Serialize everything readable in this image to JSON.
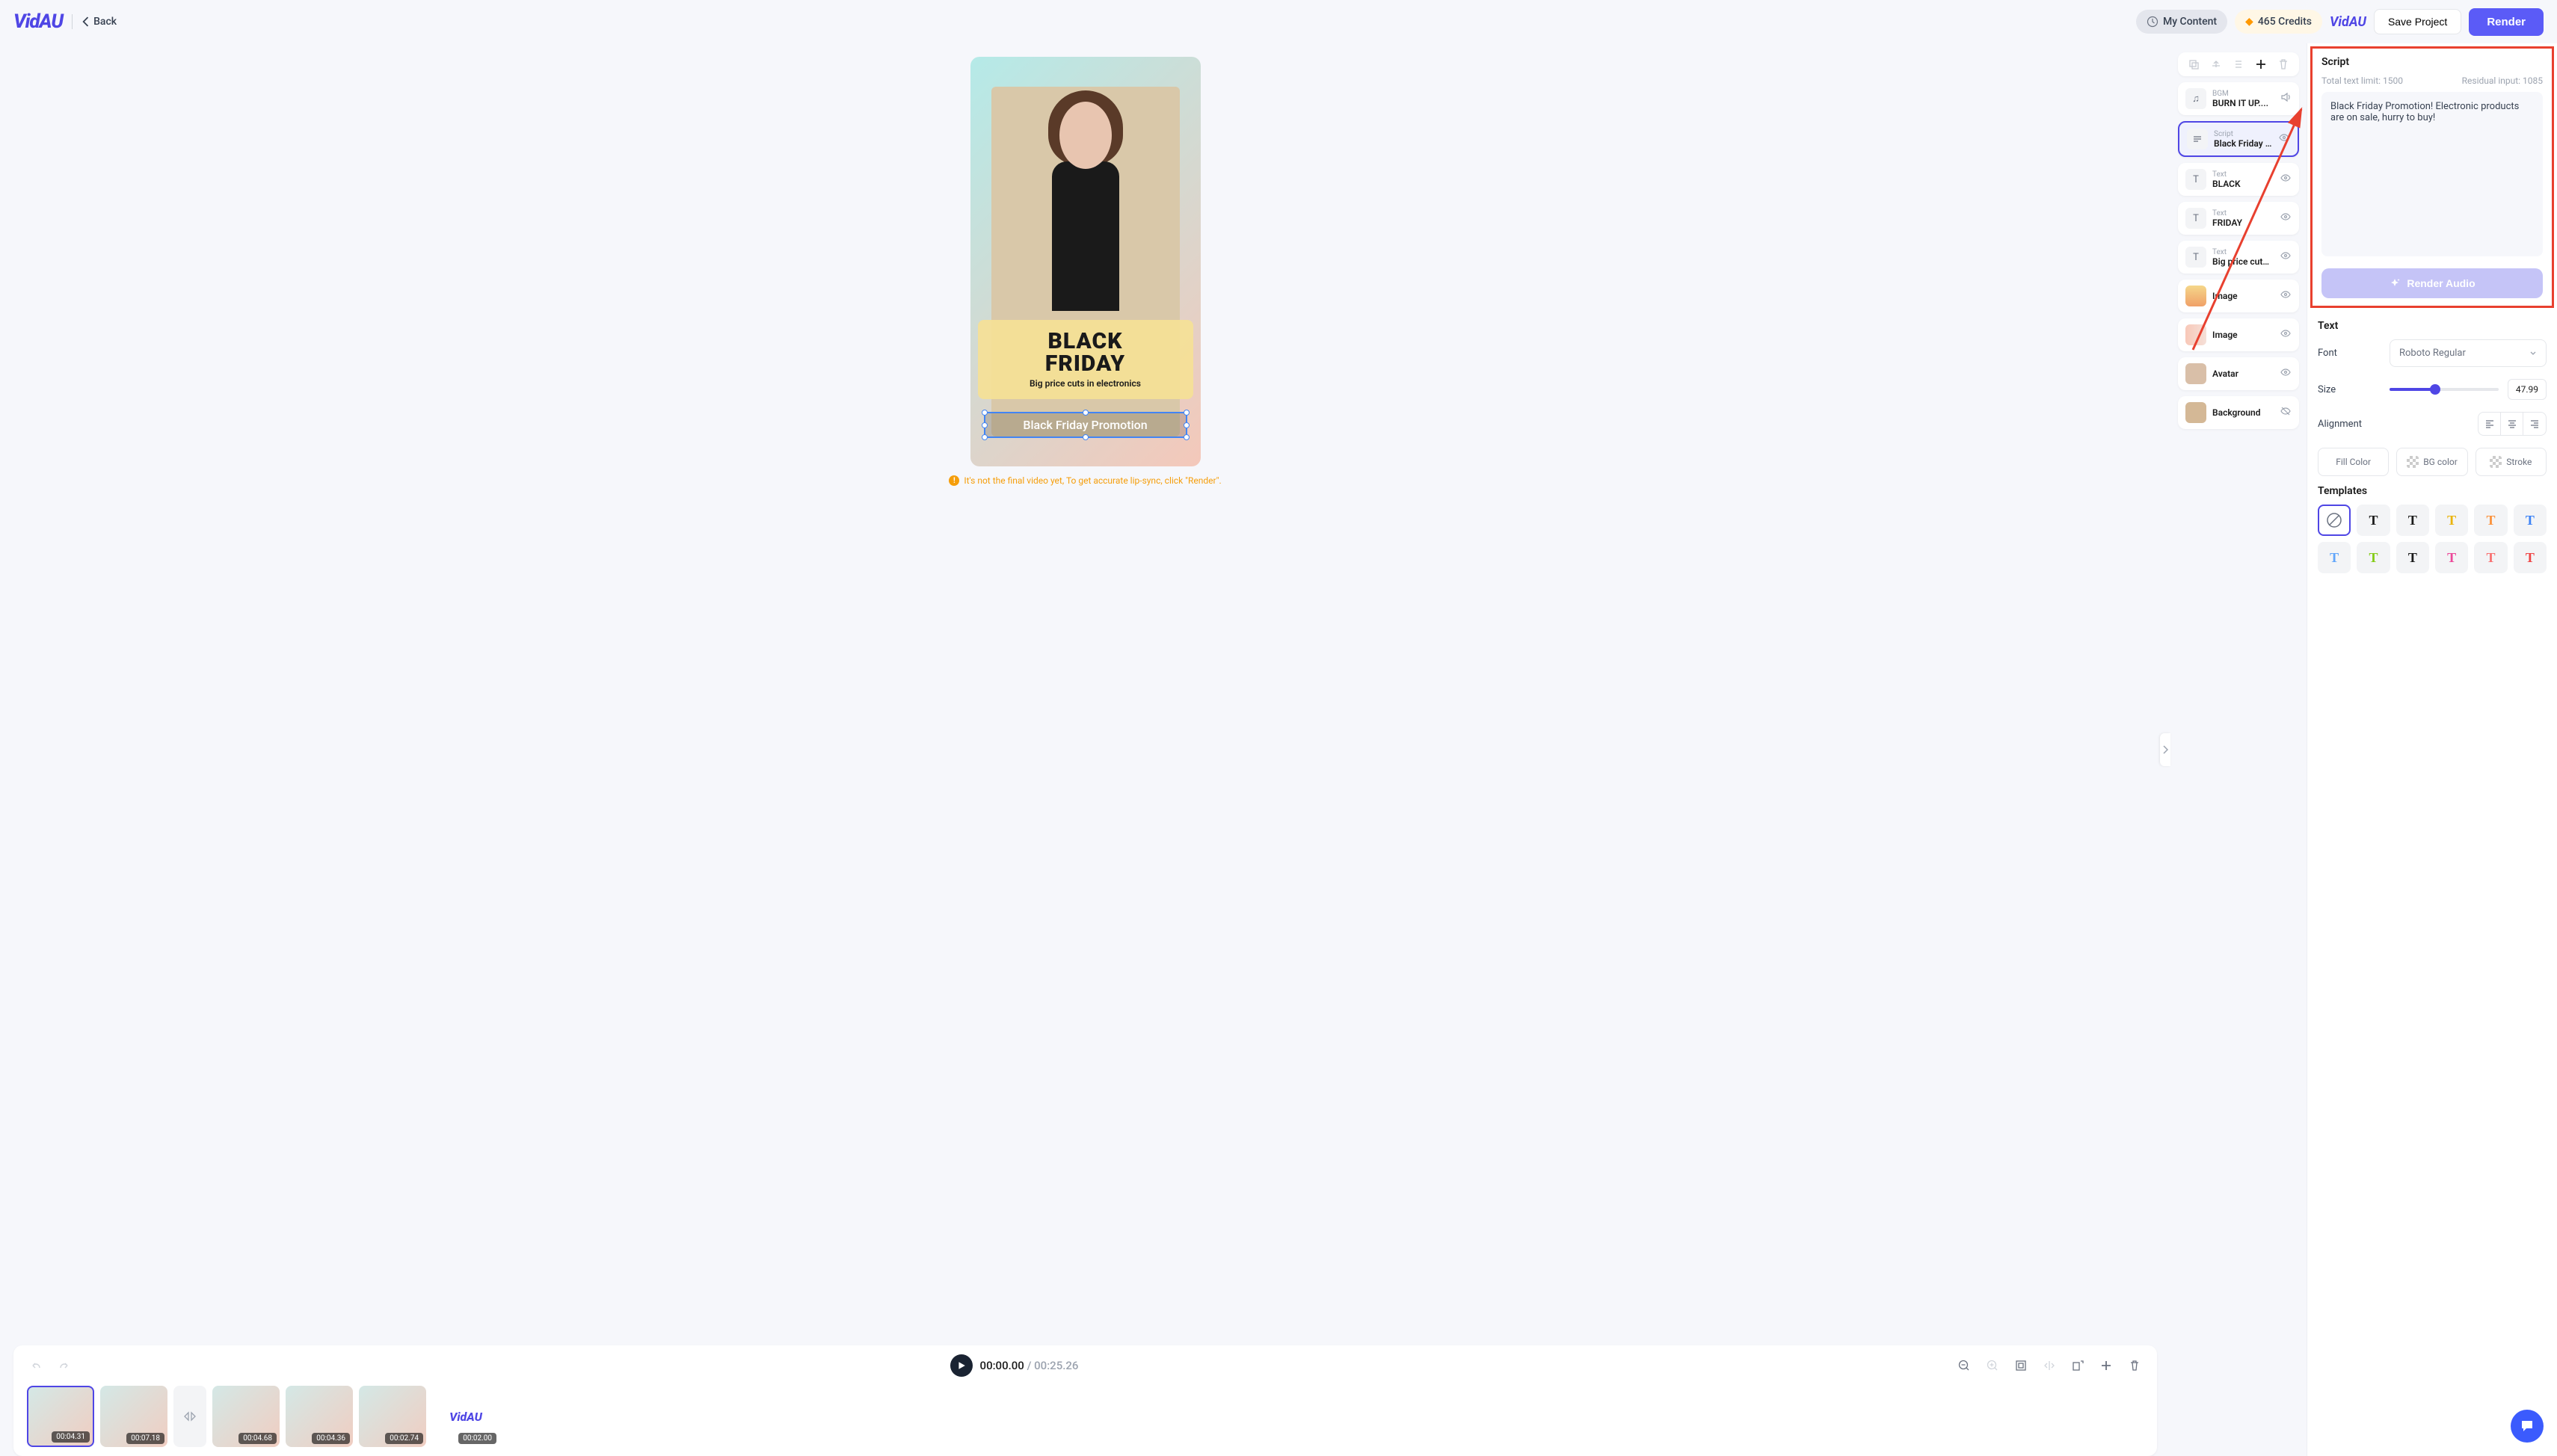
{
  "header": {
    "logo": "VidAU",
    "back_label": "Back",
    "my_content_label": "My Content",
    "credits_label": "465 Credits",
    "vidau_badge": "VidAU",
    "save_label": "Save Project",
    "render_label": "Render"
  },
  "canvas": {
    "overlay_line1": "BLACK",
    "overlay_line2": "FRIDAY",
    "overlay_line3": "Big price cuts in electronics",
    "selected_text": "Black Friday Promotion",
    "hint": "It's not the final video yet, To get accurate lip-sync, click \"Render\"."
  },
  "timeline": {
    "current_time": "00:00.00",
    "duration": "00:25.26",
    "clips": [
      {
        "time": "00:04.31",
        "active": true
      },
      {
        "time": "00:07.18",
        "active": false
      },
      {
        "time": "00:04.68",
        "active": false
      },
      {
        "time": "00:04.36",
        "active": false
      },
      {
        "time": "00:02.74",
        "active": false
      },
      {
        "time": "00:02.00",
        "active": false,
        "logo": true
      }
    ]
  },
  "layers": [
    {
      "icon": "music",
      "label": "BGM",
      "value": "BURN IT UP....",
      "vis_icon": "speaker"
    },
    {
      "icon": "script",
      "label": "Script",
      "value": "Black Friday …",
      "vis_icon": "eye",
      "selected": true
    },
    {
      "icon": "T",
      "label": "Text",
      "value": "BLACK",
      "vis_icon": "eye"
    },
    {
      "icon": "T",
      "label": "Text",
      "value": "FRIDAY",
      "vis_icon": "eye"
    },
    {
      "icon": "T",
      "label": "Text",
      "value": "Big price cuts…",
      "vis_icon": "eye"
    },
    {
      "icon": "img1",
      "label": "",
      "value": "Image",
      "vis_icon": "eye"
    },
    {
      "icon": "img2",
      "label": "",
      "value": "Image",
      "vis_icon": "eye"
    },
    {
      "icon": "avatar",
      "label": "",
      "value": "Avatar",
      "vis_icon": "eye"
    },
    {
      "icon": "bg",
      "label": "",
      "value": "Background",
      "vis_icon": "eye-off"
    }
  ],
  "script": {
    "title": "Script",
    "limit_label": "Total text limit: 1500",
    "residual_label": "Residual input: 1085",
    "content": "Black Friday Promotion! Electronic products are on sale, hurry to buy!",
    "render_audio_label": "Render Audio"
  },
  "text_props": {
    "title": "Text",
    "font_label": "Font",
    "font_value": "Roboto Regular",
    "size_label": "Size",
    "size_value": "47.99",
    "alignment_label": "Alignment",
    "fill_label": "Fill Color",
    "bg_label": "BG color",
    "stroke_label": "Stroke"
  },
  "templates": {
    "title": "Templates"
  }
}
